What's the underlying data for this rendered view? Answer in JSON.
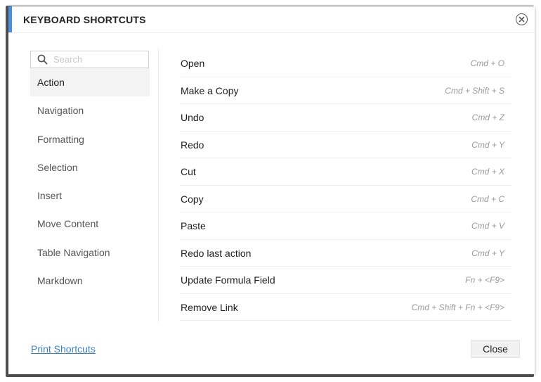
{
  "dialog": {
    "title": "KEYBOARD SHORTCUTS",
    "accent_color": "#4a90d9"
  },
  "search": {
    "placeholder": "Search",
    "value": ""
  },
  "categories": [
    {
      "label": "Action",
      "active": true
    },
    {
      "label": "Navigation"
    },
    {
      "label": "Formatting"
    },
    {
      "label": "Selection"
    },
    {
      "label": "Insert"
    },
    {
      "label": "Move Content"
    },
    {
      "label": "Table Navigation"
    },
    {
      "label": "Markdown"
    }
  ],
  "shortcuts": [
    {
      "action": "Open",
      "keys": "Cmd + O"
    },
    {
      "action": "Make a Copy",
      "keys": "Cmd + Shift + S"
    },
    {
      "action": "Undo",
      "keys": "Cmd + Z"
    },
    {
      "action": "Redo",
      "keys": "Cmd + Y"
    },
    {
      "action": "Cut",
      "keys": "Cmd + X"
    },
    {
      "action": "Copy",
      "keys": "Cmd + C"
    },
    {
      "action": "Paste",
      "keys": "Cmd + V"
    },
    {
      "action": "Redo last action",
      "keys": "Cmd + Y"
    },
    {
      "action": "Update Formula Field",
      "keys": "Fn + <F9>"
    },
    {
      "action": "Remove Link",
      "keys": "Cmd + Shift + Fn + <F9>"
    }
  ],
  "footer": {
    "print_label": "Print Shortcuts",
    "close_label": "Close",
    "link_color": "#3b82c4"
  },
  "icons": {
    "close": "close-icon",
    "search": "search-icon"
  }
}
